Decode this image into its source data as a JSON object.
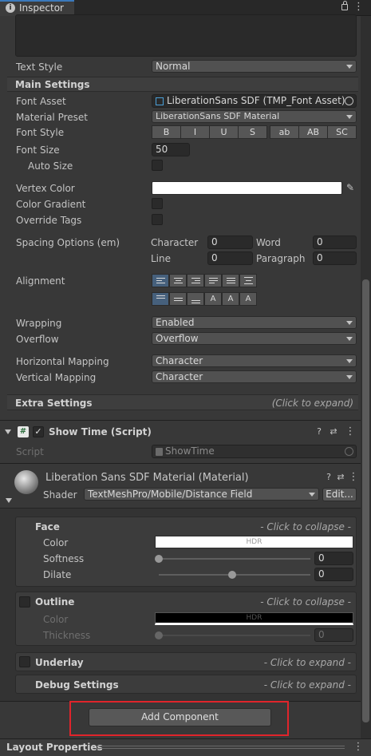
{
  "window": {
    "tab_title": "Inspector"
  },
  "text_style": {
    "label": "Text Style",
    "value": "Normal"
  },
  "main_settings": {
    "header": "Main Settings",
    "font_asset": {
      "label": "Font Asset",
      "value": "LiberationSans SDF (TMP_Font Asset)"
    },
    "material_preset": {
      "label": "Material Preset",
      "value": "LiberationSans SDF Material"
    },
    "font_style": {
      "label": "Font Style",
      "buttons": [
        "B",
        "I",
        "U",
        "S",
        "ab",
        "AB",
        "SC"
      ]
    },
    "font_size": {
      "label": "Font Size",
      "value": "50"
    },
    "auto_size": {
      "label": "Auto Size"
    },
    "vertex_color": {
      "label": "Vertex Color"
    },
    "color_gradient": {
      "label": "Color Gradient"
    },
    "override_tags": {
      "label": "Override Tags"
    },
    "spacing": {
      "label": "Spacing Options (em)",
      "character_label": "Character",
      "character_value": "0",
      "word_label": "Word",
      "word_value": "0",
      "line_label": "Line",
      "line_value": "0",
      "paragraph_label": "Paragraph",
      "paragraph_value": "0"
    },
    "alignment": {
      "label": "Alignment"
    },
    "wrapping": {
      "label": "Wrapping",
      "value": "Enabled"
    },
    "overflow": {
      "label": "Overflow",
      "value": "Overflow"
    },
    "horizontal_mapping": {
      "label": "Horizontal Mapping",
      "value": "Character"
    },
    "vertical_mapping": {
      "label": "Vertical Mapping",
      "value": "Character"
    }
  },
  "extra_settings": {
    "header": "Extra Settings",
    "hint": "(Click to expand)"
  },
  "show_time": {
    "title": "Show Time (Script)",
    "script_label": "Script",
    "script_value": "ShowTime"
  },
  "material": {
    "title": "Liberation Sans SDF Material (Material)",
    "shader_label": "Shader",
    "shader_value": "TextMeshPro/Mobile/Distance Field",
    "edit_label": "Edit...",
    "face": {
      "header": "Face",
      "hint": "- Click to collapse -",
      "color_label": "Color",
      "color_hdr": "HDR",
      "softness_label": "Softness",
      "softness_value": "0",
      "dilate_label": "Dilate",
      "dilate_value": "0"
    },
    "outline": {
      "header": "Outline",
      "hint": "- Click to collapse -",
      "color_label": "Color",
      "color_hdr": "HDR",
      "thickness_label": "Thickness",
      "thickness_value": "0"
    },
    "underlay": {
      "header": "Underlay",
      "hint": "- Click to expand -"
    },
    "debug": {
      "header": "Debug Settings",
      "hint": "- Click to expand -"
    }
  },
  "add_component_label": "Add Component",
  "layout_properties_label": "Layout Properties",
  "colors": {
    "panel_bg": "#383838",
    "accent_selected": "#46607c",
    "highlight_border": "#e0242b",
    "vertex_color": "#ffffff"
  }
}
